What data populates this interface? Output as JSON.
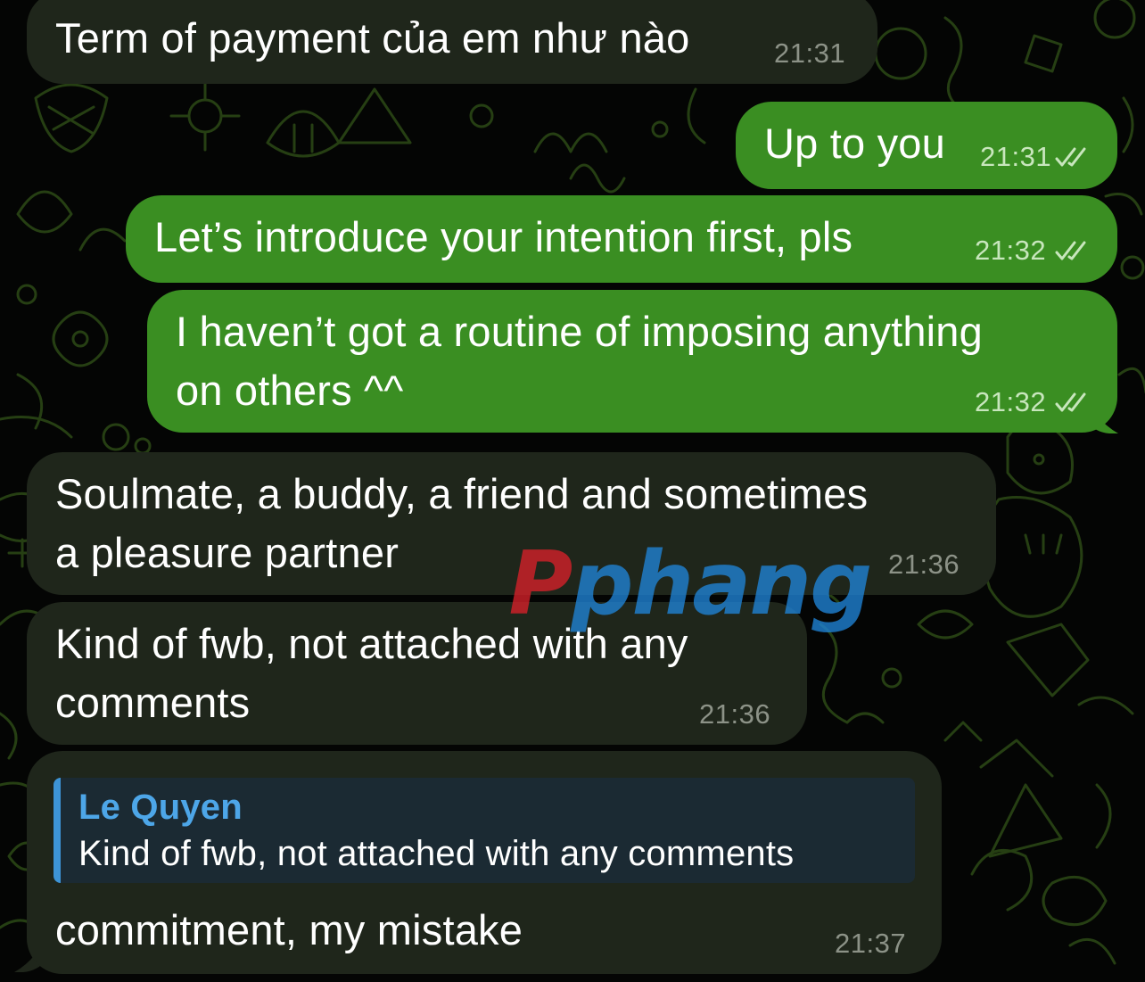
{
  "messages": [
    {
      "direction": "incoming",
      "text": "Term of payment của em như nào",
      "time": "21:31"
    },
    {
      "direction": "outgoing",
      "text": "Up to you",
      "time": "21:31",
      "status": "read"
    },
    {
      "direction": "outgoing",
      "text": "Let’s introduce your intention first, pls",
      "time": "21:32",
      "status": "read"
    },
    {
      "direction": "outgoing",
      "lines": [
        "I haven’t got a routine of imposing anything",
        "on others ^^"
      ],
      "time": "21:32",
      "status": "read"
    },
    {
      "direction": "incoming",
      "lines": [
        "Soulmate, a buddy, a friend and sometimes",
        "a pleasure partner"
      ],
      "time": "21:36"
    },
    {
      "direction": "incoming",
      "lines": [
        "Kind of fwb, not attached with any",
        "comments"
      ],
      "time": "21:36"
    },
    {
      "direction": "incoming",
      "reply_to": {
        "author": "Le Quyen",
        "text": "Kind of fwb, not attached with any comments"
      },
      "text": "commitment, my mistake",
      "time": "21:37"
    }
  ],
  "watermark": {
    "part1": "P",
    "part2": "phang"
  },
  "colors": {
    "outgoing_bubble": "#3a8e22",
    "incoming_bubble": "#1f261b",
    "reply_accent": "#3d94d6",
    "reply_author": "#4da6e8",
    "wallpaper_doodle": "#2c4a16"
  },
  "icons": {
    "read_receipt": "double-check-icon",
    "wallpaper": "doodle-pattern"
  }
}
